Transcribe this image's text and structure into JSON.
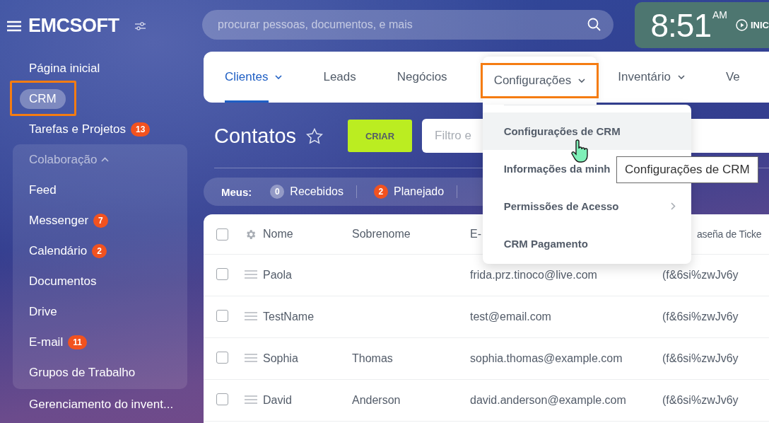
{
  "sidebar": {
    "logo": "EMCSOFT",
    "items": [
      {
        "label": "Página inicial",
        "selected": false,
        "highlighted": false
      },
      {
        "label": "CRM",
        "selected": true,
        "highlighted": true
      },
      {
        "label": "Tarefas e Projetos",
        "badge": "13",
        "selected": false,
        "highlighted": false
      }
    ],
    "group": {
      "title": "Colaboração",
      "expanded": true,
      "items": [
        {
          "label": "Feed",
          "selected": false
        },
        {
          "label": "Messenger",
          "badge": "7",
          "selected": false
        },
        {
          "label": "Calendário",
          "badge": "2",
          "selected": false
        },
        {
          "label": "Documentos",
          "selected": false
        },
        {
          "label": "Drive",
          "selected": false
        },
        {
          "label": "E-mail",
          "badge": "11",
          "selected": false
        },
        {
          "label": "Grupos de Trabalho",
          "selected": false
        }
      ]
    },
    "more_items": [
      {
        "label": "Gerenciamento do invent...",
        "selected": false
      }
    ]
  },
  "search": {
    "placeholder": "procurar pessoas, documentos, e mais"
  },
  "clock": {
    "time": "8:51",
    "period": "AM",
    "action": "INIC"
  },
  "nav": {
    "tabs": [
      {
        "label": "Clientes",
        "selected": true,
        "dropdown": true,
        "highlighted": false
      },
      {
        "label": "Leads",
        "selected": false,
        "dropdown": false,
        "highlighted": false
      },
      {
        "label": "Negócios",
        "selected": false,
        "dropdown": false,
        "highlighted": false
      },
      {
        "label": "Configurações",
        "selected": false,
        "dropdown": true,
        "highlighted": true
      },
      {
        "label": "Inventário",
        "selected": false,
        "dropdown": true,
        "highlighted": false
      },
      {
        "label": "Ve",
        "selected": false,
        "dropdown": false,
        "highlighted": false
      }
    ],
    "open_menu": {
      "items": [
        {
          "label": "Configurações de CRM",
          "hovered": true,
          "submenu": false
        },
        {
          "label": "Informações da minh",
          "hovered": false,
          "submenu": false
        },
        {
          "label": "Permissões de Acesso",
          "hovered": false,
          "submenu": true
        },
        {
          "label": "CRM Pagamento",
          "hovered": false,
          "submenu": false
        }
      ]
    },
    "tooltip": "Configurações de CRM"
  },
  "page": {
    "title": "Contatos",
    "favorite": false,
    "create_button": "CRIAR",
    "filter_placeholder": "Filtro e"
  },
  "counters": {
    "label": "Meus:",
    "items": [
      {
        "count": "0",
        "label": "Recebidos",
        "kind": "neutral"
      },
      {
        "count": "2",
        "label": "Planejado",
        "kind": "alert"
      }
    ]
  },
  "table": {
    "header_checked": false,
    "columns": [
      "Nome",
      "Sobrenome",
      "E-",
      "aseña de Ticke"
    ],
    "rows": [
      {
        "checked": false,
        "cells": [
          "Paola",
          "",
          "frida.prz.tinoco@live.com",
          "(f&6si%zwJv6y"
        ]
      },
      {
        "checked": false,
        "cells": [
          "TestName",
          "",
          "test@email.com",
          "(f&6si%zwJv6y"
        ]
      },
      {
        "checked": false,
        "cells": [
          "Sophia",
          "Thomas",
          "sophia.thomas@example.com",
          "(f&6si%zwJv6y"
        ]
      },
      {
        "checked": false,
        "cells": [
          "David",
          "Anderson",
          "david.anderson@example.com",
          "(f&6si%zwJv6y"
        ]
      }
    ]
  }
}
